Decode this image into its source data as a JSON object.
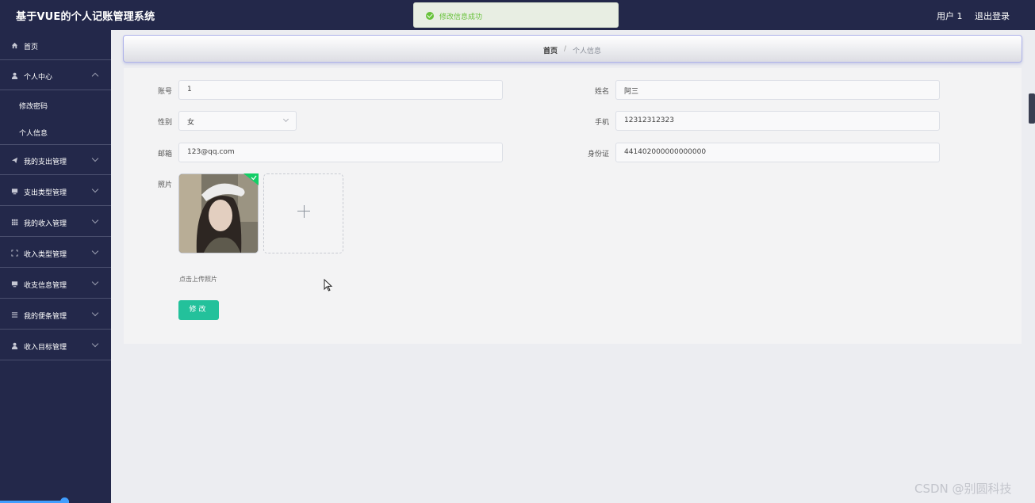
{
  "header": {
    "app_title": "基于VUE的个人记账管理系统",
    "user_label": "用户 1",
    "logout_label": "退出登录"
  },
  "toast": {
    "message": "修改信息成功",
    "status_color": "#67c23a"
  },
  "sidebar": {
    "items": [
      {
        "label": "首页",
        "icon": "home-icon"
      },
      {
        "label": "个人中心",
        "icon": "user-icon",
        "expanded": true,
        "children": [
          {
            "label": "修改密码"
          },
          {
            "label": "个人信息"
          }
        ]
      },
      {
        "label": "我的支出管理",
        "icon": "paper-plane-icon"
      },
      {
        "label": "支出类型管理",
        "icon": "monitor-icon"
      },
      {
        "label": "我的收入管理",
        "icon": "grid-icon"
      },
      {
        "label": "收入类型管理",
        "icon": "frame-icon"
      },
      {
        "label": "收支信息管理",
        "icon": "monitor-icon"
      },
      {
        "label": "我的便条管理",
        "icon": "list-icon"
      },
      {
        "label": "收入目标管理",
        "icon": "user-icon"
      }
    ]
  },
  "breadcrumb": {
    "home": "首页",
    "separator": "/",
    "current": "个人信息"
  },
  "form": {
    "account": {
      "label": "账号",
      "value": "1"
    },
    "name": {
      "label": "姓名",
      "value": "阿三"
    },
    "gender": {
      "label": "性别",
      "value": "女"
    },
    "phone": {
      "label": "手机",
      "value": "12312312323"
    },
    "email": {
      "label": "邮箱",
      "value": "123@qq.com"
    },
    "id_card": {
      "label": "身份证",
      "value": "441402000000000000"
    },
    "photo": {
      "label": "照片",
      "upload_tip": "点击上传照片"
    },
    "submit_label": "修改"
  },
  "watermark": "CSDN @别圆科技",
  "colors": {
    "header_bg": "#23284a",
    "accent": "#23c19b",
    "page_bg": "#ecedf1"
  }
}
